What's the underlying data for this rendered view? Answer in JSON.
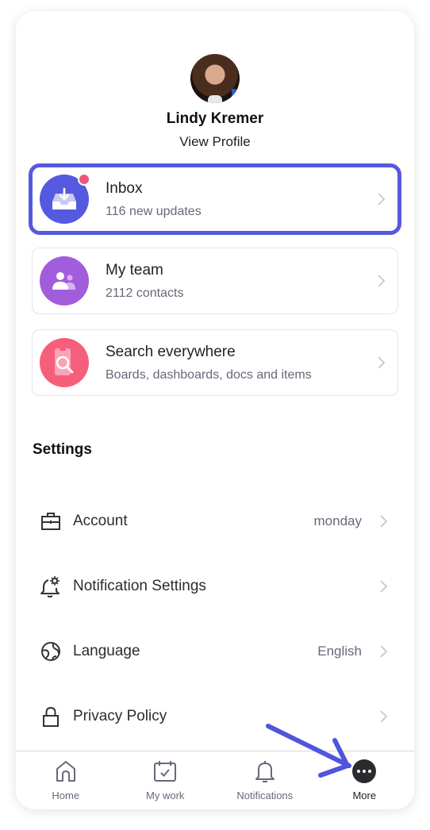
{
  "profile": {
    "name": "Lindy Kremer",
    "view_profile_label": "View Profile"
  },
  "cards": [
    {
      "id": "inbox",
      "title": "Inbox",
      "subtitle": "116 new updates",
      "icon": "inbox-download-icon",
      "color": "#5559df",
      "has_notification_dot": true,
      "highlighted": true
    },
    {
      "id": "my-team",
      "title": "My team",
      "subtitle": "2112 contacts",
      "icon": "team-icon",
      "color": "#a25ddc",
      "has_notification_dot": false,
      "highlighted": false
    },
    {
      "id": "search",
      "title": "Search everywhere",
      "subtitle": "Boards, dashboards, docs and items",
      "icon": "search-icon",
      "color": "#f65f7c",
      "has_notification_dot": false,
      "highlighted": false
    }
  ],
  "settings": {
    "title": "Settings",
    "items": [
      {
        "label": "Account",
        "value": "monday",
        "icon": "briefcase-icon"
      },
      {
        "label": "Notification Settings",
        "value": "",
        "icon": "bell-gear-icon"
      },
      {
        "label": "Language",
        "value": "English",
        "icon": "globe-icon"
      },
      {
        "label": "Privacy Policy",
        "value": "",
        "icon": "lock-icon"
      }
    ]
  },
  "tabbar": {
    "items": [
      {
        "label": "Home",
        "icon": "home-icon",
        "active": false
      },
      {
        "label": "My work",
        "icon": "calendar-check-icon",
        "active": false
      },
      {
        "label": "Notifications",
        "icon": "bell-icon",
        "active": false
      },
      {
        "label": "More",
        "icon": "more-dots-icon",
        "active": true
      }
    ]
  },
  "annotation": {
    "arrow_color": "#4f55dd",
    "points_to": "More"
  }
}
